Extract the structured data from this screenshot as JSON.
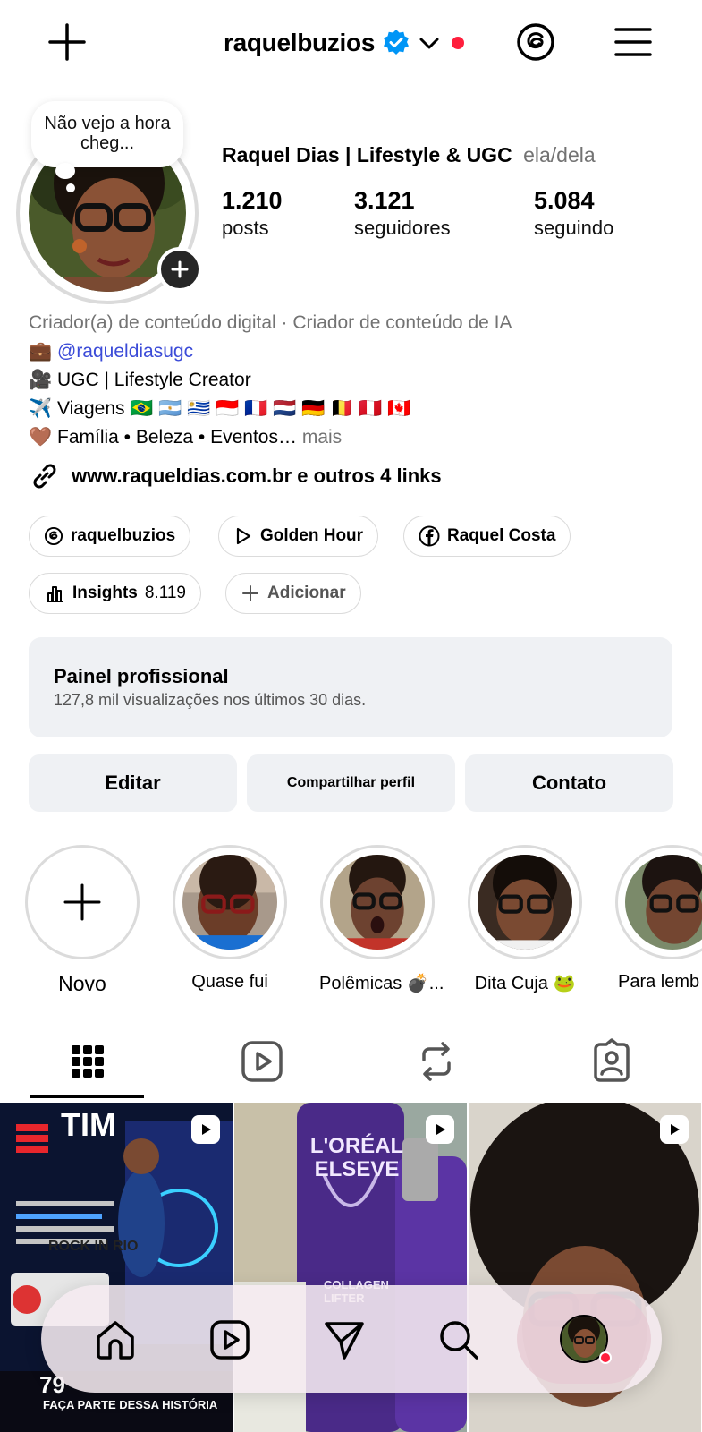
{
  "header": {
    "username": "raquelbuzios",
    "verified": true,
    "notification_dot_color": "#ff1f3d"
  },
  "profile": {
    "note": "Não vejo a hora  cheg...",
    "display_name": "Raquel Dias | Lifestyle & UGC",
    "pronouns": "ela/dela",
    "stats": [
      {
        "value": "1.210",
        "label": "posts"
      },
      {
        "value": "3.121",
        "label": "seguidores"
      },
      {
        "value": "5.084",
        "label": "seguindo"
      }
    ],
    "category": "Criador(a) de conteúdo digital · Criador de conteúdo de IA",
    "bio_lines": [
      {
        "emoji": "💼",
        "text": "@raqueldiasugc"
      },
      {
        "emoji": "🎥",
        "text": "UGC | Lifestyle Creator"
      },
      {
        "emoji": "✈️",
        "text": "Viagens 🇧🇷 🇦🇷 🇺🇾 🇮🇩 🇫🇷 🇳🇱 🇩🇪 🇧🇪 🇵🇪 🇨🇦"
      },
      {
        "emoji": "🤎",
        "text": "Família • Beleza • Eventos…"
      }
    ],
    "more_label": "mais",
    "link": "www.raqueldias.com.br e outros 4 links"
  },
  "chips": {
    "threads": "raquelbuzios",
    "golden_hour": "Golden Hour",
    "facebook": "Raquel Costa",
    "insights_label": "Insights",
    "insights_value": "8.119",
    "add": "Adicionar"
  },
  "panel": {
    "title": "Painel profissional",
    "subtitle": "127,8 mil visualizações nos últimos 30 dias."
  },
  "actions": {
    "edit": "Editar",
    "share": "Compartilhar perfil",
    "contact": "Contato"
  },
  "highlights": [
    {
      "label": "Novo"
    },
    {
      "label": "Quase fui"
    },
    {
      "label": "Polêmicas 💣..."
    },
    {
      "label": "Dita Cuja 🐸"
    },
    {
      "label": "Para lemb"
    }
  ],
  "grid_posts": [
    {
      "text": "TIM",
      "overlay": "ROCK IN RIO",
      "footer": "FAÇA PARTE DESSA HISTÓRIA",
      "views": "79"
    },
    {
      "text": "L'ORÉAL ELSEVE",
      "overlay": "COLLAGEN LIFTER"
    },
    {
      "text": ""
    }
  ]
}
